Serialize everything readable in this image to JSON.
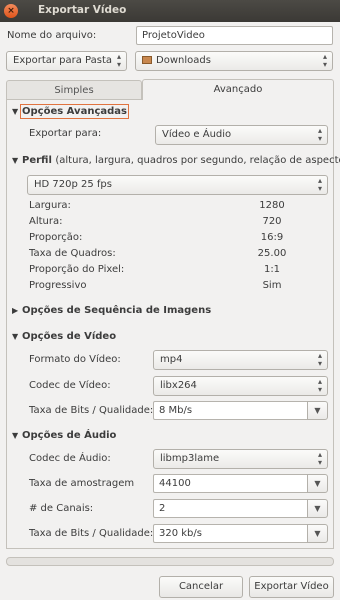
{
  "window": {
    "title": "Exportar Vídeo",
    "close_glyph": "×"
  },
  "filename": {
    "label": "Nome do arquivo:",
    "value": "ProjetoVideo"
  },
  "export_mode": {
    "value": "Exportar para Pasta"
  },
  "folder": {
    "value": "Downloads",
    "icon": "folder-icon"
  },
  "tabs": [
    {
      "label": "Simples"
    },
    {
      "label": "Avançado"
    }
  ],
  "advanced": {
    "header": "Opções Avançadas",
    "export_to_label": "Exportar para:",
    "export_to_value": "Vídeo e Áudio"
  },
  "profile": {
    "header_bold": "Perfil",
    "header_rest": "(altura, largura, quadros por segundo, relação de aspecto)",
    "value": "HD 720p 25 fps",
    "rows": [
      {
        "label": "Largura:",
        "value": "1280"
      },
      {
        "label": "Altura:",
        "value": "720"
      },
      {
        "label": "Proporção:",
        "value": "16:9"
      },
      {
        "label": "Taxa de Quadros:",
        "value": "25.00"
      },
      {
        "label": "Proporção do Pixel:",
        "value": "1:1"
      },
      {
        "label": "Progressivo",
        "value": "Sim"
      }
    ]
  },
  "image_seq": {
    "header": "Opções de Sequência de Imagens"
  },
  "video": {
    "header": "Opções de Vídeo",
    "format_label": "Formato do Vídeo:",
    "format_value": "mp4",
    "codec_label": "Codec de Vídeo:",
    "codec_value": "libx264",
    "bitrate_label": "Taxa de Bits / Qualidade:",
    "bitrate_value": "8 Mb/s"
  },
  "audio": {
    "header": "Opções de Áudio",
    "codec_label": "Codec de Áudio:",
    "codec_value": "libmp3lame",
    "samplerate_label": "Taxa de amostragem",
    "samplerate_value": "44100",
    "channels_label": "# de Canais:",
    "channels_value": "2",
    "bitrate_label": "Taxa de Bits / Qualidade:",
    "bitrate_value": "320 kb/s"
  },
  "progress": {
    "value": 0
  },
  "buttons": {
    "cancel": "Cancelar",
    "export": "Exportar Vídeo"
  },
  "colors": {
    "titlebar": "#3c3b37",
    "close": "#e95420",
    "focus": "#e0733f"
  }
}
